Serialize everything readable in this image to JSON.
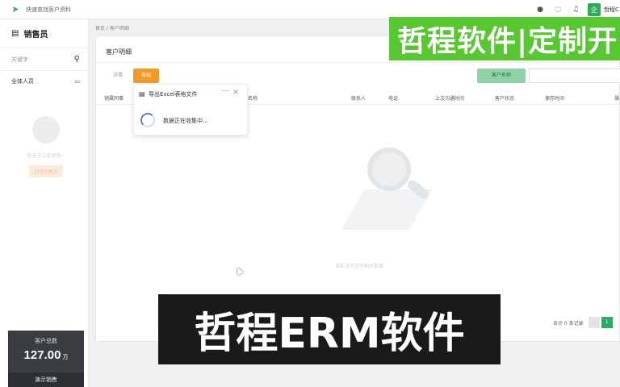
{
  "topbar": {
    "search_link": "快速查找客户资料",
    "enterprise_badge": "企",
    "company_name": "哲程C"
  },
  "sidebar": {
    "title": "销售员",
    "search_placeholder": "关键字",
    "all_staff": "全体人员",
    "empty_text": "暂无员工数据哦~",
    "create_button": "创建销售员"
  },
  "stat": {
    "label": "客户总数",
    "value": "127.00",
    "unit": "万",
    "demo_button": "演示销售"
  },
  "breadcrumb": "首页 / 客户明细",
  "panel": {
    "title": "客户明细",
    "detail_button": "详情",
    "export_button": "导出",
    "filter_button": "客户名称",
    "columns": [
      "销属同事",
      "名称",
      "联系人",
      "电话",
      "上次沟通时间",
      "客户状态",
      "保存时间",
      "操"
    ],
    "empty_message": "当前没有任何相关数据",
    "pager": {
      "total": "合计 0 条记录",
      "current_page": "1"
    }
  },
  "popup": {
    "title": "导出Excel表格文件",
    "status": "数据正在收集中..."
  },
  "overlay": {
    "banner": "哲程软件|定制开",
    "caption": "哲程ERM软件"
  }
}
